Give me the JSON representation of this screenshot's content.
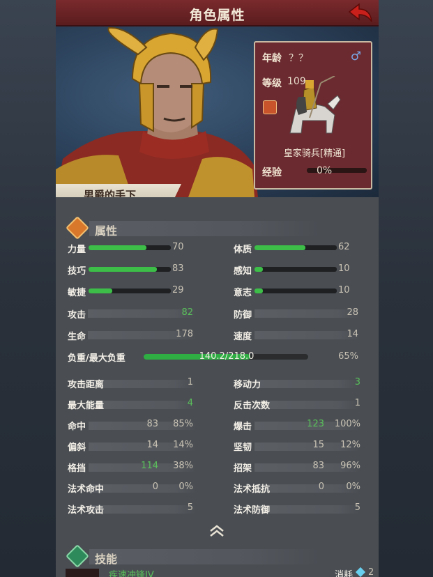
{
  "header": {
    "title": "角色属性"
  },
  "unit": {
    "age_label": "年龄",
    "age_value": "？？",
    "gender_symbol": "♂",
    "level_label": "等级",
    "level_value": "109",
    "name": "皇家骑兵[精通]",
    "xp_label": "经验",
    "xp_value": "0%",
    "xp_fraction": 0
  },
  "character": {
    "title_banner": "男爵的手下"
  },
  "attributes": {
    "section_title": "属性",
    "pip_stats": [
      {
        "label": "力量",
        "value": "70",
        "fill": 0.7
      },
      {
        "label": "体质",
        "value": "62",
        "fill": 0.62
      },
      {
        "label": "技巧",
        "value": "83",
        "fill": 0.83
      },
      {
        "label": "感知",
        "value": "10",
        "fill": 0.1
      },
      {
        "label": "敏捷",
        "value": "29",
        "fill": 0.29
      },
      {
        "label": "意志",
        "value": "10",
        "fill": 0.1
      }
    ],
    "attack_label": "攻击",
    "attack_value": "82",
    "defense_label": "防御",
    "defense_value": "28",
    "hp_label": "生命",
    "hp_value": "178",
    "speed_label": "速度",
    "speed_value": "14",
    "load_label": "负重/最大负重",
    "load_value": "140.2/218.0",
    "load_percent": "65%",
    "load_fraction": 0.65,
    "grid": [
      {
        "label": "攻击距离",
        "a": "1",
        "b": ""
      },
      {
        "label": "移动力",
        "a": "3",
        "b": ""
      },
      {
        "label": "最大能量",
        "a": "4",
        "b": ""
      },
      {
        "label": "反击次数",
        "a": "1",
        "b": ""
      },
      {
        "label": "命中",
        "a": "83",
        "b": "85%"
      },
      {
        "label": "爆击",
        "a": "123",
        "b": "100%"
      },
      {
        "label": "偏斜",
        "a": "14",
        "b": "14%"
      },
      {
        "label": "坚韧",
        "a": "15",
        "b": "12%"
      },
      {
        "label": "格挡",
        "a": "114",
        "b": "38%"
      },
      {
        "label": "招架",
        "a": "83",
        "b": "96%"
      },
      {
        "label": "法术命中",
        "a": "0",
        "b": "0%"
      },
      {
        "label": "法术抵抗",
        "a": "0",
        "b": "0%"
      },
      {
        "label": "法术攻击",
        "a": "5",
        "b": ""
      },
      {
        "label": "法术防御",
        "a": "5",
        "b": ""
      }
    ]
  },
  "skills": {
    "section_title": "技能",
    "first_skill_name": "疾速冲锋IV",
    "cost_label": "消耗",
    "cost_value": "2"
  },
  "colors": {
    "accent_green": "#3cbe48",
    "header_red": "#7a2a2c",
    "attr_icon": "#d9782a",
    "skill_icon": "#2e8a5a"
  }
}
